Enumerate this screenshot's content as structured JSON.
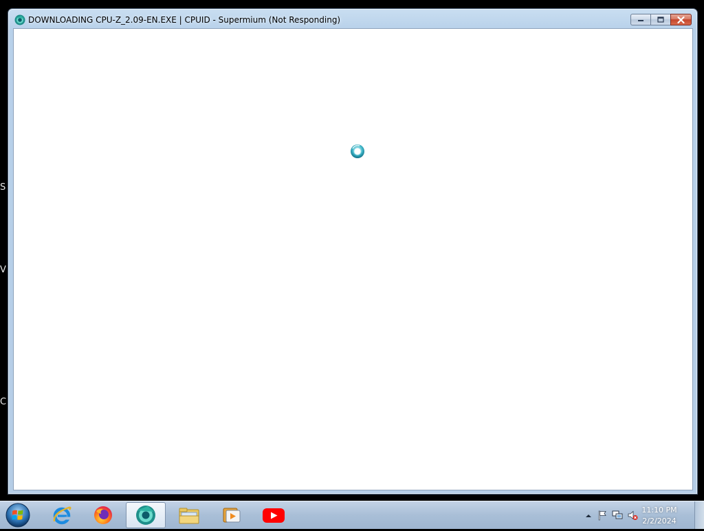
{
  "window": {
    "title": "DOWNLOADING CPU-Z_2.09-EN.EXE | CPUID - Supermium (Not Responding)",
    "icon": "supermium-browser-icon",
    "buttons": [
      "minimize",
      "maximize",
      "close"
    ]
  },
  "content": {
    "state": "loading",
    "spinner": "busy-spinner-icon"
  },
  "desktop_glimpse": [
    "S",
    "V",
    "C"
  ],
  "taskbar": {
    "start": "windows-start-orb",
    "pinned": [
      {
        "name": "internet-explorer",
        "active": false
      },
      {
        "name": "firefox",
        "active": false
      },
      {
        "name": "supermium",
        "active": true
      },
      {
        "name": "file-explorer",
        "active": false
      },
      {
        "name": "media-player",
        "active": false
      },
      {
        "name": "youtube",
        "active": false
      }
    ],
    "tray": {
      "icons": [
        "show-hidden-icons-arrow",
        "action-center-flag",
        "network-icon",
        "volume-muted-icon"
      ],
      "time": "11:10 PM",
      "date": "2/2/2024"
    }
  },
  "colors": {
    "window_frame": "#b8d1ea",
    "taskbar": "#a9bfd7",
    "close_button": "#c4452b",
    "youtube_red": "#ff0000"
  }
}
